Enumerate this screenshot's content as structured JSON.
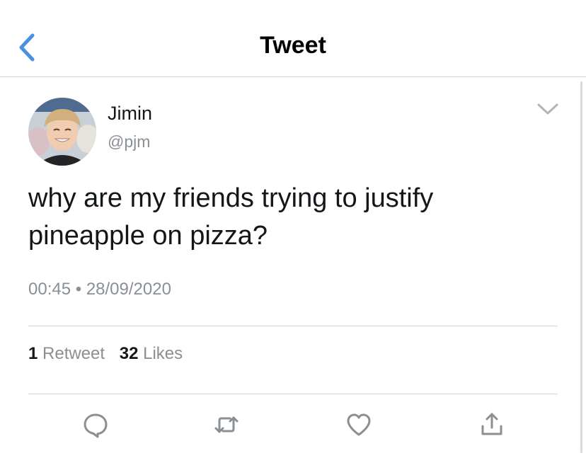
{
  "nav": {
    "title": "Tweet",
    "back_icon": "chevron-left-icon"
  },
  "tweet": {
    "user_name": "Jimin",
    "handle": "@pjm",
    "text_line1": "why are my friends trying to justify",
    "text_line2": "pineapple on pizza?",
    "time": "00:45",
    "separator": "•",
    "date": "28/09/2020",
    "more_icon": "chevron-down-icon"
  },
  "stats": {
    "retweet_count": "1",
    "retweet_label": "Retweet",
    "like_count": "32",
    "like_label": "Likes"
  },
  "actions": [
    "reply-icon",
    "retweet-icon",
    "like-icon",
    "share-icon"
  ],
  "colors": {
    "accent": "#4a90e2",
    "icon_gray": "#8a8f94",
    "text": "#14171a",
    "divider": "#d3d3d3"
  }
}
